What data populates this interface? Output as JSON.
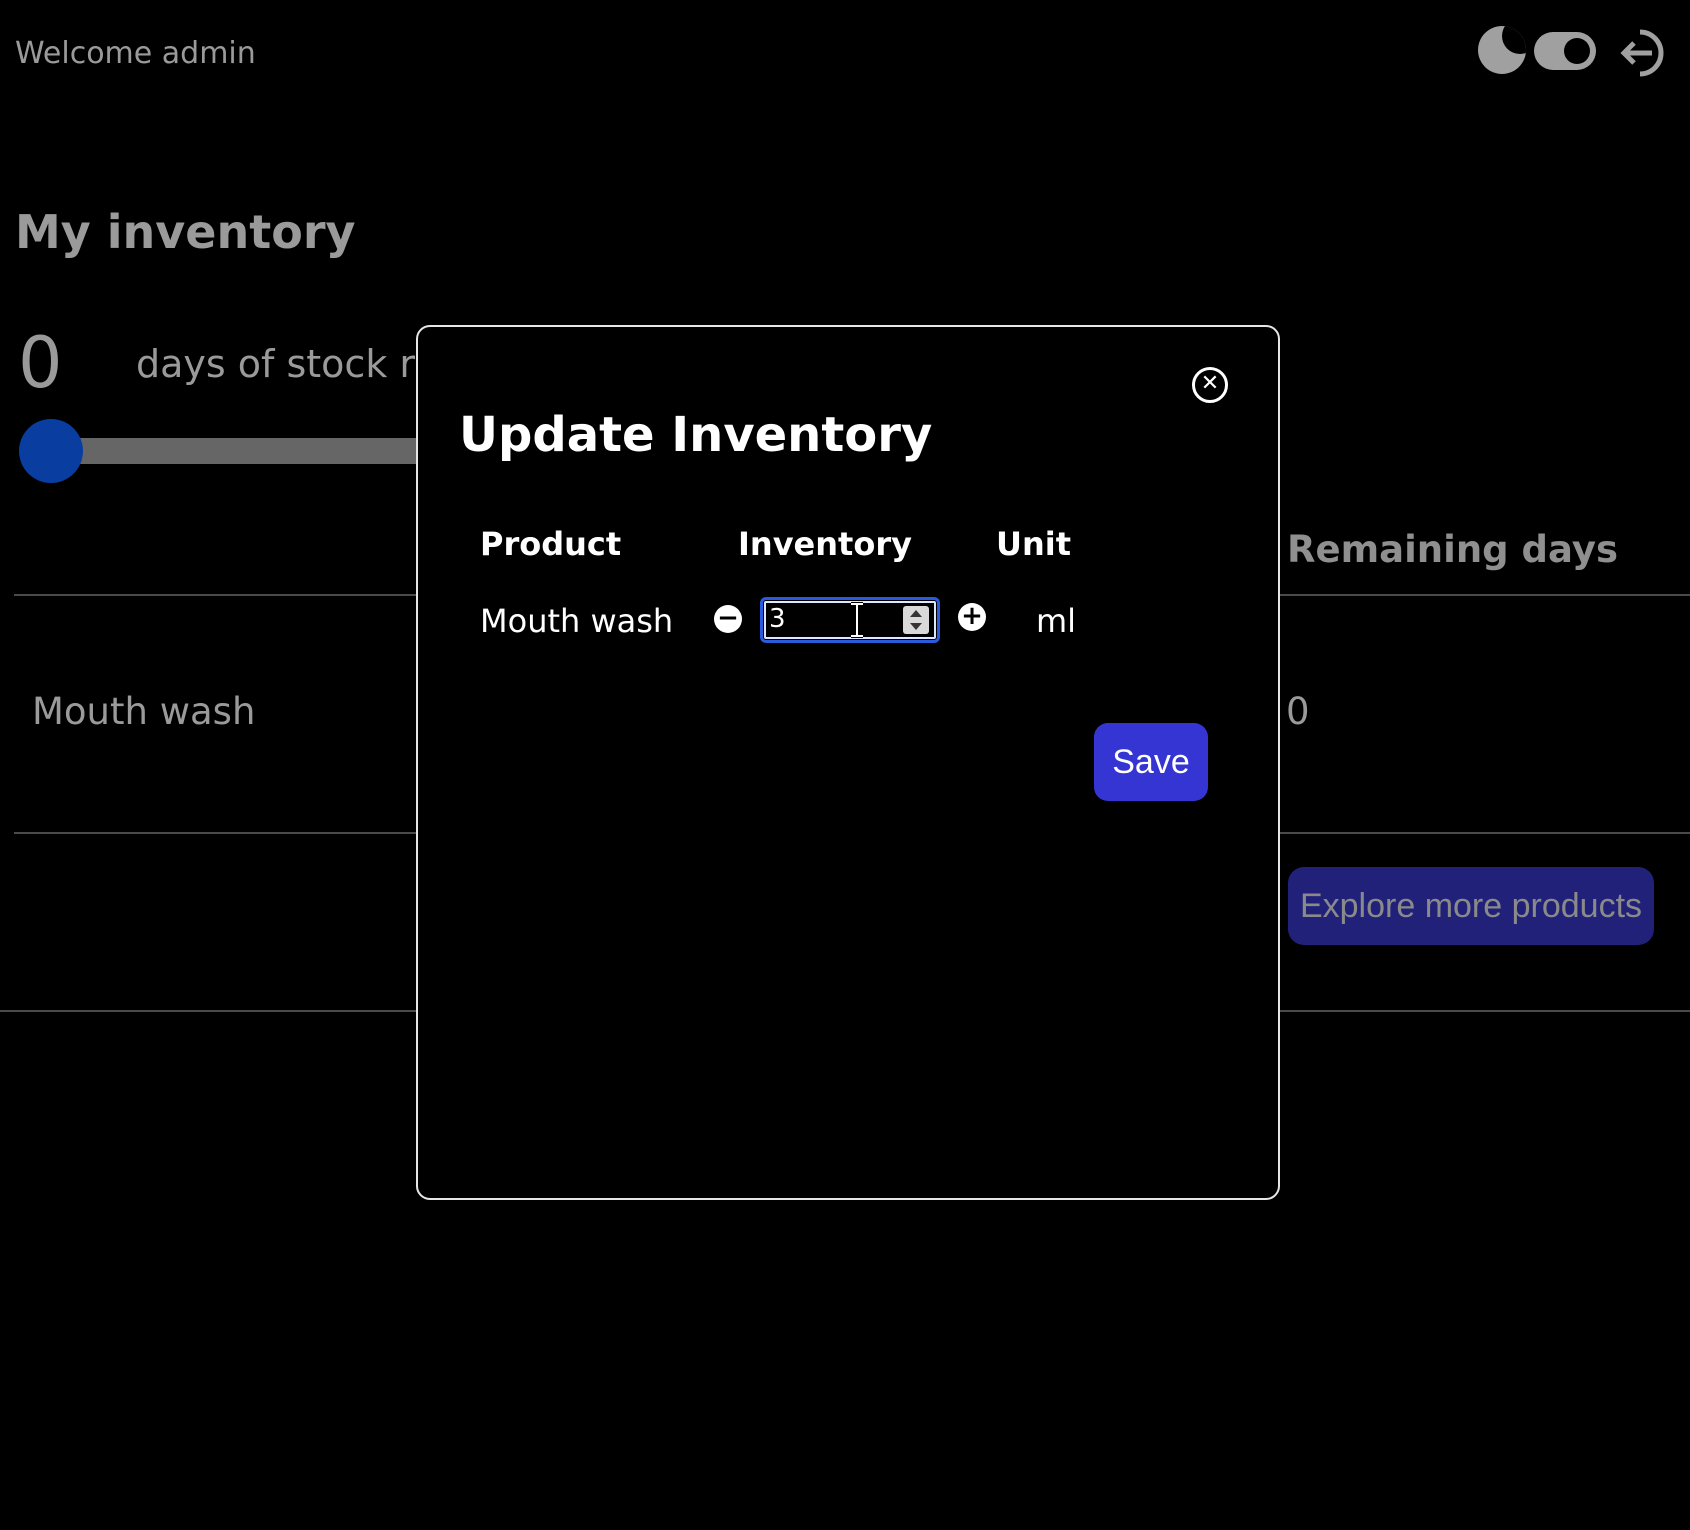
{
  "header": {
    "welcome_text": "Welcome admin",
    "icons": [
      "moon-icon",
      "theme-toggle",
      "logout-icon"
    ]
  },
  "inventory_page": {
    "title": "My inventory",
    "days_value": "0",
    "days_label": "days of stock re",
    "slider_value": 0,
    "columns": {
      "remaining_days": "Remaining days"
    },
    "rows": [
      {
        "product": "Mouth wash",
        "remaining": "0"
      }
    ],
    "explore_button_label": "Explore more products"
  },
  "modal": {
    "title": "Update Inventory",
    "close_icon": "close-circle-icon",
    "headers": {
      "product": "Product",
      "inventory": "Inventory",
      "unit": "Unit"
    },
    "row": {
      "product": "Mouth wash",
      "inventory_value": "3",
      "unit": "ml"
    },
    "decrement_symbol": "−",
    "increment_symbol": "+",
    "save_label": "Save"
  },
  "colors": {
    "background": "#000000",
    "primary_button": "#3535d4",
    "slider_thumb": "#0a3da0",
    "focus_border": "#2a5bdc"
  }
}
